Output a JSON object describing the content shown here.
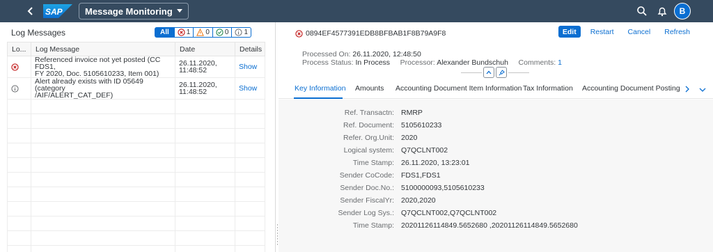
{
  "shell": {
    "title": "Message Monitoring",
    "avatar_initial": "B",
    "logo_text": "SAP",
    "colors": {
      "shell_bg": "#354a5f",
      "accent": "#0a6ed1"
    }
  },
  "log": {
    "title": "Log Messages",
    "filters": {
      "all": "All",
      "errors": "1",
      "warnings": "0",
      "success": "0",
      "info": "1"
    },
    "columns": [
      "Lo...",
      "Log Message",
      "Date",
      "Details"
    ],
    "rows": [
      {
        "status": "error",
        "message_line1": "Referenced invoice not yet posted (CC FDS1,",
        "message_line2": "FY 2020, Doc. 5105610233, Item 001)",
        "date_line1": "26.11.2020,",
        "date_line2": "11:48:52",
        "details": "Show"
      },
      {
        "status": "info",
        "message_line1": "Alert already exists with ID 05649 (category",
        "message_line2": "/AIF/ALERT_CAT_DEF)",
        "date_line1": "26.11.2020,",
        "date_line2": "11:48:52",
        "details": "Show"
      }
    ]
  },
  "detail": {
    "message_id": "0894EF4577391EDB8BFBAB1F8B79A9F8",
    "actions": {
      "edit": "Edit",
      "restart": "Restart",
      "cancel": "Cancel",
      "refresh": "Refresh"
    },
    "processed_on_label": "Processed On:",
    "processed_on": "26.11.2020, 12:48:50",
    "process_status_label": "Process Status:",
    "process_status": "In Process",
    "processor_label": "Processor:",
    "processor": "Alexander Bundschuh",
    "comments_label": "Comments:",
    "comments": "1",
    "tabs": [
      "Key Information",
      "Amounts",
      "Accounting Document Item Information",
      "Tax Information",
      "Accounting Document Posting Dat"
    ],
    "fields": [
      {
        "label": "Ref. Transactn:",
        "value": "RMRP"
      },
      {
        "label": "Ref. Document:",
        "value": "5105610233"
      },
      {
        "label": "Refer. Org.Unit:",
        "value": "2020"
      },
      {
        "label": "Logical system:",
        "value": "Q7QCLNT002"
      },
      {
        "label": "Time Stamp:",
        "value": "26.11.2020, 13:23:01"
      },
      {
        "label": "Sender CoCode:",
        "value": "FDS1,FDS1"
      },
      {
        "label": "Sender Doc.No.:",
        "value": "5100000093,5105610233"
      },
      {
        "label": "Sender FiscalYr:",
        "value": "2020,2020"
      },
      {
        "label": "Sender Log Sys.:",
        "value": "Q7QCLNT002,Q7QCLNT002"
      },
      {
        "label": "Time Stamp:",
        "value": "20201126114849.5652680 ,20201126114849.5652680"
      }
    ]
  }
}
